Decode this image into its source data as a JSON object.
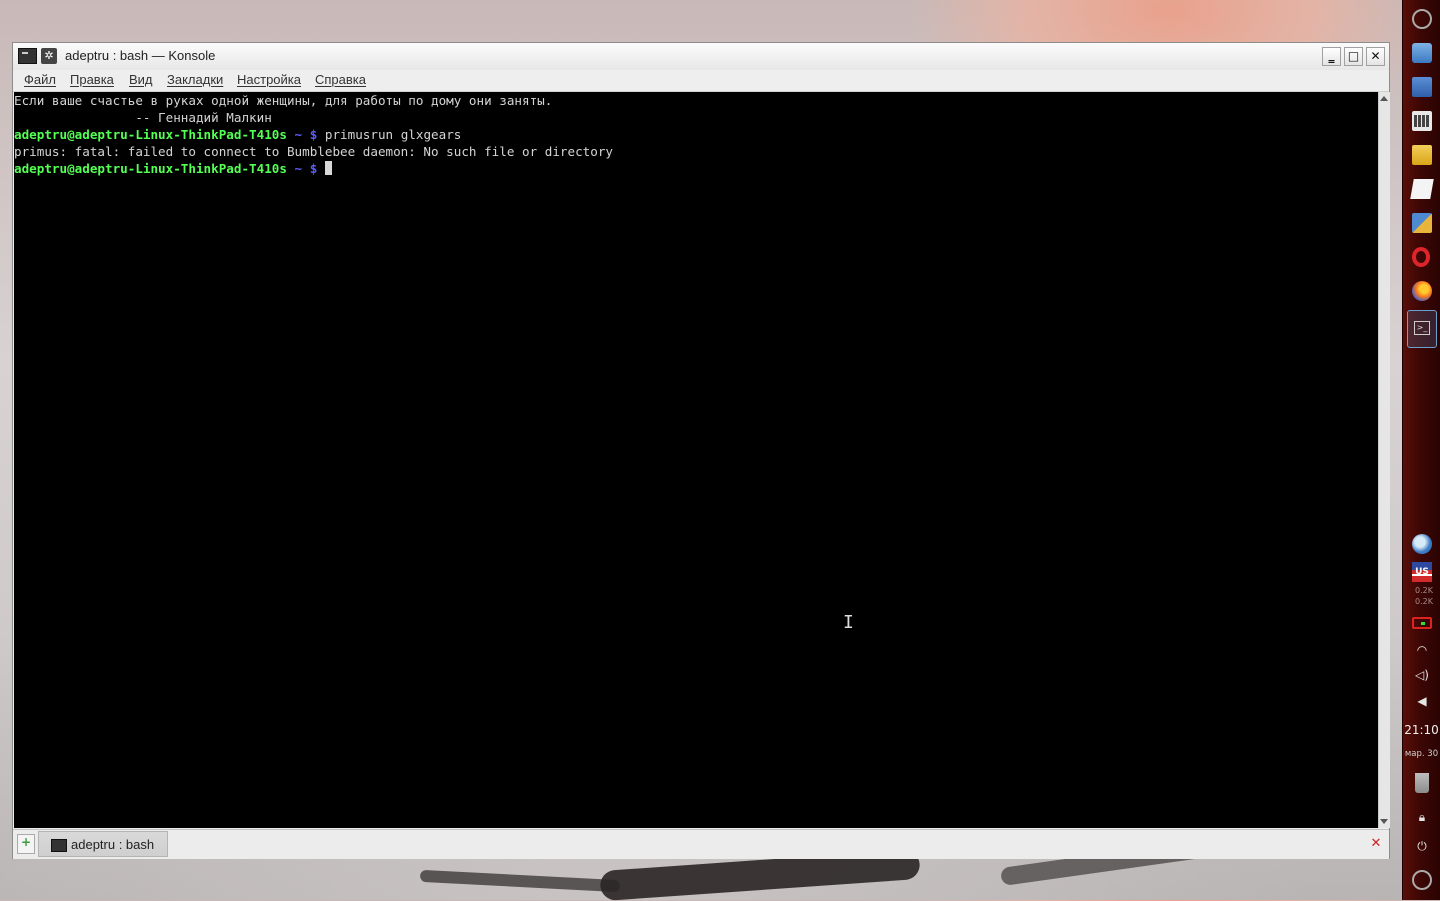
{
  "window": {
    "title": "adeptru : bash — Konsole"
  },
  "menu": [
    "Файл",
    "Правка",
    "Вид",
    "Закладки",
    "Настройка",
    "Справка"
  ],
  "terminal": {
    "lines": [
      {
        "kind": "text",
        "text": "Если ваше счастье в руках одной женщины, для работы по дому они заняты."
      },
      {
        "kind": "text",
        "text": "                -- Геннадий Малкин"
      },
      {
        "kind": "prompt",
        "user": "adeptru@adeptru-Linux-ThinkPad-T410s",
        "tail": " ~ $ ",
        "cmd": "primusrun glxgears"
      },
      {
        "kind": "text",
        "text": "primus: fatal: failed to connect to Bumblebee daemon: No such file or directory"
      },
      {
        "kind": "prompt",
        "user": "adeptru@adeptru-Linux-ThinkPad-T410s",
        "tail": " ~ $ ",
        "cmd": ""
      }
    ]
  },
  "tabs": [
    {
      "label": "adeptru : bash"
    }
  ],
  "panel": {
    "net_up": "0.2K",
    "net_down": "0.2K",
    "clock": "21:10",
    "date": "мар. 30"
  },
  "colors": {
    "prompt_user": "#54ff54",
    "prompt_tail": "#5c5cff",
    "terminal_bg": "#000000",
    "terminal_fg": "#d4d4d4",
    "panel_bg": "#3a0604"
  }
}
